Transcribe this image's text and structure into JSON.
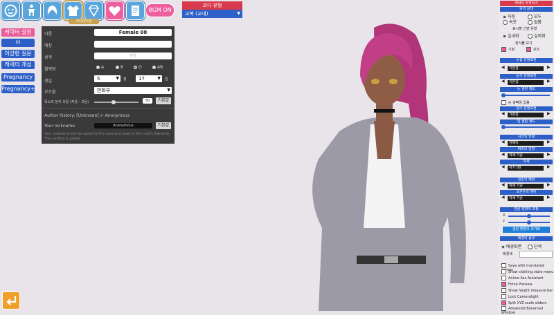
{
  "top_icons": [
    {
      "name": "face-icon"
    },
    {
      "name": "body-icon"
    },
    {
      "name": "hair-icon"
    },
    {
      "name": "clothing-icon"
    },
    {
      "name": "accessory-icon"
    },
    {
      "name": "heart-icon"
    },
    {
      "name": "document-icon"
    }
  ],
  "top_tooltip": "코디네이션",
  "bgm_label": "BGM ON",
  "nav": [
    "캐릭터 설정",
    "H",
    "이상형 질문",
    "캐릭터 개성",
    "Pregnancy",
    "Pregnancy+"
  ],
  "panel": {
    "name_label": "이름",
    "name_value": "Female 08",
    "nickname_label": "애칭",
    "personality_label": "성격",
    "personality_value": "평범",
    "blood_label": "혈액형",
    "blood_options": [
      "A",
      "B",
      "O",
      "AB"
    ],
    "birthday_label": "생일",
    "month_value": "5",
    "month_unit": "월",
    "day_value": "17",
    "day_unit": "일",
    "attitude_label": "부끄움",
    "attitude_value": "만화부",
    "voice_label": "목소리 높이 조절 (저음 - 고음)",
    "voice_value": "50",
    "reset_label": "기본값",
    "author_history": "Author history: [Unknown] > Anonymous",
    "your_nickname_label": "Your nickname",
    "your_nickname_value": "Anonymous",
    "nickname_reset": "기본값",
    "nickname_note": "Your nickname will be saved to the card and used in the card's filename. This setting is global"
  },
  "coord": {
    "title": "코디 유형",
    "value": "교복 (교내)"
  },
  "right": {
    "header": "캐릭터 조작하기",
    "clothing_state": "옷의 상태",
    "clothing_opts": [
      "자동",
      "모두",
      "속옷",
      "알몸"
    ],
    "display_label": "표시할 신발 유형",
    "shoe_opts": [
      "실내화",
      "실외화"
    ],
    "accessory_label": "장식물 보기",
    "acc_opts": [
      "기본",
      "보조"
    ],
    "eye_expr_label": "눈썹 감정표현",
    "eye_expr_value": "기본값",
    "eye_label": "눈의 감정표현",
    "eye_value": "기본값",
    "eye_open_label": "눈 열린 정도",
    "blink_label": "눈 깜빡임 없음",
    "mouth_label": "입의 감정표현",
    "mouth_value": "기본값",
    "mouth_open_label": "입 열린 정도",
    "gaze_label": "시선의 방향",
    "gaze_value": "카메라",
    "head_label": "머리의 방향",
    "head_value": "자세 기준",
    "pose_label": "자세",
    "pose_value": "서기 08",
    "lhand_label": "왼손의 패턴",
    "lhand_value": "자세 기준",
    "rhand_label": "오른손의 패턴",
    "rhand_value": "자세 기준",
    "light_label": "광원 방향의 조정",
    "light_x": "X",
    "light_y": "Y",
    "light_reset": "광원 방향의 초기화",
    "bg_label": "배경의 종류",
    "bg_opts": [
      "배경화면",
      "단색"
    ],
    "bg_color": "배경색",
    "checks": [
      {
        "label": "Save with translated names",
        "on": false
      },
      {
        "label": "Show clothing state menu",
        "on": false
      },
      {
        "label": "Anime Ass Assistant",
        "on": false
      },
      {
        "label": "Force Preview",
        "on": true
      },
      {
        "label": "Show height measure bar",
        "on": false
      },
      {
        "label": "Lock Cameralight",
        "on": false
      },
      {
        "label": "Split XYZ scale sliders",
        "on": true
      },
      {
        "label": "Advanced Bonemod Window",
        "on": false
      }
    ]
  },
  "colors": {
    "accent_blue": "#2d5fc8",
    "accent_pink": "#e85d97",
    "accent_red": "#d8394d"
  }
}
